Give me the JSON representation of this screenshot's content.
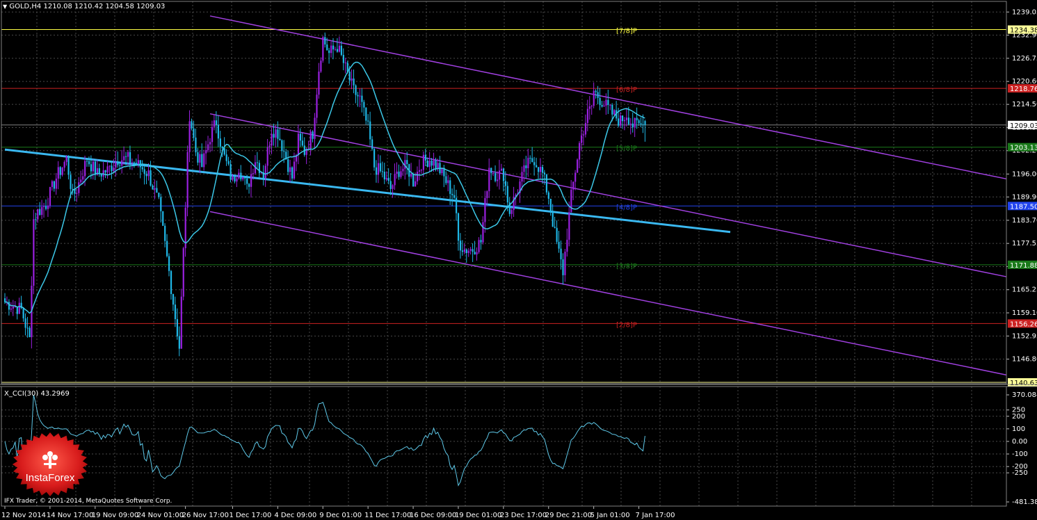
{
  "header": {
    "title": "GOLD,H4  1210.08 1210.42 1204.58 1209.03"
  },
  "indicator": {
    "title": "X_CCI(30) 43.2969",
    "scale": [
      "370.084",
      "250",
      "200",
      "100",
      "0.00",
      "-100",
      "-200",
      "-250",
      "-481.3897"
    ],
    "scale_values": [
      370.084,
      250,
      200,
      100,
      0,
      -100,
      -200,
      -250,
      -481.3897
    ]
  },
  "footer": {
    "copyright": "IFX Trader, © 2001-2014, MetaQuotes Software Corp."
  },
  "logo": {
    "text": "InstaForex"
  },
  "price_scale": {
    "labels": [
      "1239.05",
      "1232.90",
      "1226.75",
      "1220.60",
      "1214.50",
      "1208.35",
      "1202.20",
      "1196.00",
      "1189.90",
      "1183.70",
      "1177.55",
      "1171.40",
      "1165.25",
      "1159.10",
      "1152.95",
      "1146.80"
    ],
    "values": [
      1239.05,
      1232.9,
      1226.75,
      1220.6,
      1214.5,
      1208.35,
      1202.2,
      1196.0,
      1189.9,
      1183.7,
      1177.55,
      1171.4,
      1165.25,
      1159.1,
      1152.95,
      1146.8
    ]
  },
  "time_axis": {
    "labels": [
      "12 Nov 2014",
      "14 Nov 17:00",
      "19 Nov 09:00",
      "24 Nov 01:00",
      "26 Nov 17:00",
      "1 Dec 17:00",
      "4 Dec 09:00",
      "9 Dec 01:00",
      "11 Dec 17:00",
      "16 Dec 09:00",
      "19 Dec 01:00",
      "23 Dec 17:00",
      "29 Dec 21:00",
      "5 Jan 01:00",
      "7 Jan 17:00"
    ],
    "index": [
      0,
      22,
      44,
      66,
      88,
      111,
      133,
      155,
      177,
      199,
      221,
      243,
      265,
      287,
      309
    ]
  },
  "murrey_levels": [
    {
      "price": 1234.38,
      "label": "1234.38",
      "tag": "[7/8]P",
      "color": "#ffff44",
      "box_bg": "#ffff99",
      "box_fg": "#000000"
    },
    {
      "price": 1218.76,
      "label": "1218.76",
      "tag": "[6/8]P",
      "color": "#cc2222",
      "box_bg": "#cc2222",
      "box_fg": "#ffffff"
    },
    {
      "price": 1203.13,
      "label": "1203.13",
      "tag": "[5/8]P",
      "color": "#1a7a1a",
      "box_bg": "#1a7a1a",
      "box_fg": "#ffffff"
    },
    {
      "price": 1187.5,
      "label": "1187.50",
      "tag": "[4/8]P",
      "color": "#2244ee",
      "box_bg": "#2244ee",
      "box_fg": "#ffffff"
    },
    {
      "price": 1171.88,
      "label": "1171.88",
      "tag": "[3/8]P",
      "color": "#1a7a1a",
      "box_bg": "#1a7a1a",
      "box_fg": "#ffffff"
    },
    {
      "price": 1156.26,
      "label": "1156.26",
      "tag": "[2/8]P",
      "color": "#cc2222",
      "box_bg": "#cc2222",
      "box_fg": "#ffffff"
    },
    {
      "price": 1140.63,
      "label": "1140.63",
      "tag": "",
      "color": "#ffff99",
      "box_bg": "#ffff99",
      "box_fg": "#000000"
    }
  ],
  "current_price": {
    "price": 1209.03,
    "label": "1209.03"
  },
  "colors": {
    "bull": "#9a20e0",
    "bear": "#1fb8e8",
    "ma": "#3cc8e8",
    "channel": "#a040e0",
    "trendline": "#3ab8f0",
    "grid": "#4a4a4a",
    "cci": "#5ec8e8"
  },
  "chart_data": {
    "type": "candlestick",
    "symbol": "GOLD",
    "timeframe": "H4",
    "ohlc_last": {
      "open": 1210.08,
      "high": 1210.42,
      "low": 1204.58,
      "close": 1209.03
    },
    "anchors_index": [
      0,
      8,
      12,
      14,
      16,
      20,
      25,
      30,
      33,
      35,
      40,
      45,
      50,
      55,
      60,
      66,
      70,
      75,
      80,
      85,
      88,
      90,
      93,
      96,
      100,
      103,
      106,
      111,
      114,
      118,
      122,
      126,
      130,
      133,
      136,
      140,
      143,
      146,
      150,
      153,
      155,
      158,
      162,
      166,
      170,
      173,
      177,
      180,
      184,
      188,
      192,
      196,
      199,
      203,
      207,
      211,
      215,
      219,
      221,
      224,
      228,
      232,
      236,
      239,
      243,
      246,
      250,
      254,
      258,
      262,
      265,
      268,
      272,
      276,
      280,
      284,
      286,
      287,
      290,
      293,
      296,
      300,
      303,
      306,
      309,
      312
    ],
    "anchors_close": [
      1162,
      1160,
      1152,
      1184,
      1186,
      1188,
      1195,
      1200,
      1190,
      1192,
      1200,
      1196,
      1197,
      1200,
      1200,
      1198,
      1196,
      1188,
      1170,
      1150,
      1188,
      1212,
      1202,
      1198,
      1206,
      1210,
      1202,
      1194,
      1198,
      1192,
      1200,
      1196,
      1208,
      1207,
      1202,
      1195,
      1205,
      1202,
      1207,
      1224,
      1232,
      1228,
      1230,
      1224,
      1218,
      1216,
      1208,
      1198,
      1196,
      1192,
      1197,
      1198,
      1194,
      1199,
      1200,
      1198,
      1194,
      1190,
      1178,
      1176,
      1176,
      1178,
      1198,
      1196,
      1196,
      1186,
      1192,
      1198,
      1200,
      1196,
      1190,
      1180,
      1170,
      1190,
      1204,
      1212,
      1214,
      1218,
      1216,
      1214,
      1212,
      1210,
      1212,
      1209,
      1209.03,
      1209.03
    ],
    "ma_period": 20,
    "price_range": [
      1140.63,
      1241.5
    ],
    "cci_period": 30,
    "cci_last": 43.2969,
    "cci_range": [
      -481.3897,
      370.084
    ],
    "trendline": {
      "from": {
        "index": 0,
        "price": 1202.5
      },
      "to": {
        "index": 340,
        "price": 1180.4
      }
    },
    "channel": {
      "upper": {
        "from": {
          "index": 100,
          "price": 1238
        },
        "to": {
          "index": 340,
          "price": 1194.7
        }
      },
      "middle": {
        "from": {
          "index": 100,
          "price": 1212
        },
        "to": {
          "index": 340,
          "price": 1168.7
        }
      },
      "lower": {
        "from": {
          "index": 100,
          "price": 1186
        },
        "to": {
          "index": 340,
          "price": 1142.6
        }
      }
    }
  }
}
